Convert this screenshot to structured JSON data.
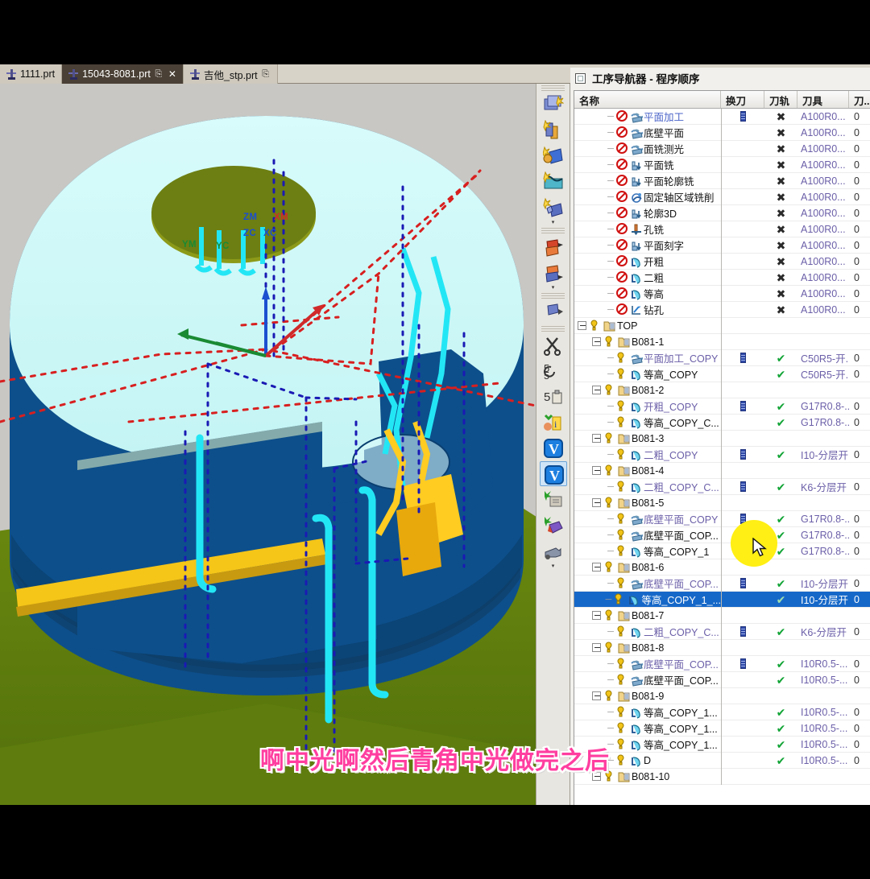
{
  "window": {
    "tabs": [
      {
        "label": "1111.prt",
        "active": false,
        "has_save": false,
        "has_close": false,
        "icon": "part-file-icon"
      },
      {
        "label": "15043-8081.prt",
        "active": true,
        "has_save": true,
        "has_close": true,
        "icon": "part-file-icon"
      },
      {
        "label": "吉他_stp.prt",
        "active": false,
        "has_save": true,
        "has_close": false,
        "icon": "part-file-icon"
      }
    ]
  },
  "viewport": {
    "background_color": "#c8c7c3",
    "part_colors": {
      "stock_top": "#ccf7f7",
      "wall": "#0d4f8b",
      "base_green": "#5e7d0e",
      "toolpath_cyan": "#23e6f5",
      "toolpath_gold": "#ffcc22",
      "rapid_red": "#d81f1f",
      "rapid_blue": "#1a1ab4"
    },
    "axis_labels": [
      {
        "name": "ZM",
        "color": "#1b4fd0"
      },
      {
        "name": "XM",
        "color": "#d02a2a"
      },
      {
        "name": "ZC",
        "color": "#1b4fd0"
      },
      {
        "name": "XC",
        "color": "#1b4fd0"
      },
      {
        "name": "YM",
        "color": "#1a8a33"
      },
      {
        "name": "YC",
        "color": "#1a8a33"
      }
    ]
  },
  "toolbar": {
    "name": "operation-toolbar",
    "buttons": [
      {
        "name": "create-geometry-button",
        "icon": "create-geometry-icon"
      },
      {
        "name": "create-tool-button",
        "icon": "create-tool-icon"
      },
      {
        "name": "create-method-button",
        "icon": "create-method-icon"
      },
      {
        "name": "workpiece-button",
        "icon": "workpiece-icon"
      },
      {
        "name": "create-operation-button",
        "icon": "create-operation-icon"
      },
      {
        "name": "generate-toolpath-button",
        "icon": "generate-toolpath-icon"
      },
      {
        "name": "replay-toolpath-button",
        "icon": "replay-toolpath-icon"
      },
      {
        "name": "verify-toolpath-button",
        "icon": "verify-toolpath-icon"
      },
      {
        "name": "cut-toolpath-button",
        "icon": "cut-toolpath-icon"
      },
      {
        "name": "copy-toolpath-button",
        "icon": "copy-toolpath-icon"
      },
      {
        "name": "paste-toolpath-button",
        "icon": "paste-toolpath-icon"
      },
      {
        "name": "transform-button",
        "icon": "transform-icon"
      },
      {
        "name": "information-button",
        "icon": "information-icon"
      },
      {
        "name": "vericut-button",
        "icon": "vericut-icon",
        "selected": true
      },
      {
        "name": "post-process-button",
        "icon": "post-process-icon"
      },
      {
        "name": "shop-doc-button",
        "icon": "shop-doc-icon"
      },
      {
        "name": "machine-sim-button",
        "icon": "machine-sim-icon"
      }
    ]
  },
  "navigator": {
    "title": "工序导航器 - 程序顺序",
    "columns": [
      "名称",
      "换刀",
      "刀轨",
      "刀具",
      "刀..."
    ],
    "scrollbar": {
      "left_arrow": "‹"
    },
    "rows": [
      {
        "indent": 2,
        "guide": "dash",
        "icon": "face-milling-icon",
        "label": "平面加工",
        "label_color": "blue",
        "status": "blocked",
        "toolchange": true,
        "path": "x",
        "tool": "A100R0...",
        "tn": "0"
      },
      {
        "indent": 2,
        "guide": "dash",
        "icon": "face-milling-icon",
        "label": "底壁平面",
        "label_color": "black",
        "status": "blocked",
        "toolchange": false,
        "path": "x",
        "tool": "A100R0...",
        "tn": "0"
      },
      {
        "indent": 2,
        "guide": "dash",
        "icon": "face-milling-icon",
        "label": "面铣测光",
        "label_color": "black",
        "status": "blocked",
        "toolchange": false,
        "path": "x",
        "tool": "A100R0...",
        "tn": "0"
      },
      {
        "indent": 2,
        "guide": "dash",
        "icon": "planar-mill-icon",
        "label": "平面铣",
        "label_color": "black",
        "status": "blocked",
        "toolchange": false,
        "path": "x",
        "tool": "A100R0...",
        "tn": "0"
      },
      {
        "indent": 2,
        "guide": "dash",
        "icon": "planar-mill-icon",
        "label": "平面轮廓铣",
        "label_color": "black",
        "status": "blocked",
        "toolchange": false,
        "path": "x",
        "tool": "A100R0...",
        "tn": "0"
      },
      {
        "indent": 2,
        "guide": "dash",
        "icon": "fixed-contour-icon",
        "label": "固定轴区域铣削",
        "label_color": "black",
        "status": "blocked",
        "toolchange": false,
        "path": "x",
        "tool": "A100R0...",
        "tn": "0"
      },
      {
        "indent": 2,
        "guide": "dash",
        "icon": "planar-mill-icon",
        "label": "轮廓3D",
        "label_color": "black",
        "status": "blocked",
        "toolchange": false,
        "path": "x",
        "tool": "A100R0...",
        "tn": "0"
      },
      {
        "indent": 2,
        "guide": "dash",
        "icon": "hole-milling-icon",
        "label": "孔铣",
        "label_color": "black",
        "status": "blocked",
        "toolchange": false,
        "path": "x",
        "tool": "A100R0...",
        "tn": "0"
      },
      {
        "indent": 2,
        "guide": "dash",
        "icon": "planar-mill-icon",
        "label": "平面刻字",
        "label_color": "black",
        "status": "blocked",
        "toolchange": false,
        "path": "x",
        "tool": "A100R0...",
        "tn": "0"
      },
      {
        "indent": 2,
        "guide": "dash",
        "icon": "cavity-mill-icon",
        "label": "开粗",
        "label_color": "black",
        "status": "blocked",
        "toolchange": false,
        "path": "x",
        "tool": "A100R0...",
        "tn": "0"
      },
      {
        "indent": 2,
        "guide": "dash",
        "icon": "cavity-mill-icon",
        "label": "二粗",
        "label_color": "black",
        "status": "blocked",
        "toolchange": false,
        "path": "x",
        "tool": "A100R0...",
        "tn": "0"
      },
      {
        "indent": 2,
        "guide": "dash",
        "icon": "cavity-mill-icon",
        "label": "等高",
        "label_color": "black",
        "status": "blocked",
        "toolchange": false,
        "path": "x",
        "tool": "A100R0...",
        "tn": "0"
      },
      {
        "indent": 2,
        "guide": "dash",
        "icon": "drilling-icon",
        "label": "钻孔",
        "label_color": "black",
        "status": "blocked",
        "toolchange": false,
        "path": "x",
        "tool": "A100R0...",
        "tn": "0"
      },
      {
        "indent": 0,
        "guide": "expander",
        "icon": "program-group-icon",
        "label": "TOP",
        "label_color": "black",
        "status": "warn",
        "toolchange": false,
        "path": "",
        "tool": "",
        "tn": ""
      },
      {
        "indent": 1,
        "guide": "expander",
        "icon": "program-group-icon",
        "label": "B081-1",
        "label_color": "black",
        "status": "warn",
        "toolchange": false,
        "path": "",
        "tool": "",
        "tn": ""
      },
      {
        "indent": 2,
        "guide": "dash",
        "icon": "face-milling-icon",
        "label": "平面加工_COPY",
        "label_color": "purple",
        "status": "warn",
        "toolchange": true,
        "path": "ok",
        "tool": "C50R5-开...",
        "tn": "0"
      },
      {
        "indent": 2,
        "guide": "dash",
        "icon": "cavity-mill-icon",
        "label": "等高_COPY",
        "label_color": "black",
        "status": "warn",
        "toolchange": false,
        "path": "ok",
        "tool": "C50R5-开...",
        "tn": "0"
      },
      {
        "indent": 1,
        "guide": "expander",
        "icon": "program-group-icon",
        "label": "B081-2",
        "label_color": "black",
        "status": "warn",
        "toolchange": false,
        "path": "",
        "tool": "",
        "tn": ""
      },
      {
        "indent": 2,
        "guide": "dash",
        "icon": "cavity-mill-icon",
        "label": "开粗_COPY",
        "label_color": "purple",
        "status": "warn",
        "toolchange": true,
        "path": "ok",
        "tool": "G17R0.8-...",
        "tn": "0"
      },
      {
        "indent": 2,
        "guide": "dash",
        "icon": "cavity-mill-icon",
        "label": "等高_COPY_C...",
        "label_color": "black",
        "status": "warn",
        "toolchange": false,
        "path": "ok",
        "tool": "G17R0.8-...",
        "tn": "0"
      },
      {
        "indent": 1,
        "guide": "expander",
        "icon": "program-group-icon",
        "label": "B081-3",
        "label_color": "black",
        "status": "warn",
        "toolchange": false,
        "path": "",
        "tool": "",
        "tn": ""
      },
      {
        "indent": 2,
        "guide": "dash",
        "icon": "cavity-mill-icon",
        "label": "二粗_COPY",
        "label_color": "purple",
        "status": "warn",
        "toolchange": true,
        "path": "ok",
        "tool": "I10-分层开",
        "tn": "0"
      },
      {
        "indent": 1,
        "guide": "expander",
        "icon": "program-group-icon",
        "label": "B081-4",
        "label_color": "black",
        "status": "warn",
        "toolchange": false,
        "path": "",
        "tool": "",
        "tn": ""
      },
      {
        "indent": 2,
        "guide": "dash",
        "icon": "cavity-mill-icon",
        "label": "二粗_COPY_C...",
        "label_color": "purple",
        "status": "warn",
        "toolchange": true,
        "path": "ok",
        "tool": "K6-分层开",
        "tn": "0"
      },
      {
        "indent": 1,
        "guide": "expander",
        "icon": "program-group-icon",
        "label": "B081-5",
        "label_color": "black",
        "status": "warn",
        "toolchange": false,
        "path": "",
        "tool": "",
        "tn": ""
      },
      {
        "indent": 2,
        "guide": "dash",
        "icon": "face-milling-icon",
        "label": "底壁平面_COPY",
        "label_color": "purple",
        "status": "warn",
        "toolchange": true,
        "path": "ok",
        "tool": "G17R0.8-...",
        "tn": "0"
      },
      {
        "indent": 2,
        "guide": "dash",
        "icon": "face-milling-icon",
        "label": "底壁平面_COP...",
        "label_color": "black",
        "status": "warn",
        "toolchange": false,
        "path": "ok",
        "tool": "G17R0.8-...",
        "tn": "0"
      },
      {
        "indent": 2,
        "guide": "dash",
        "icon": "cavity-mill-icon",
        "label": "等高_COPY_1",
        "label_color": "black",
        "status": "warn",
        "toolchange": false,
        "path": "ok",
        "tool": "G17R0.8-...",
        "tn": "0"
      },
      {
        "indent": 1,
        "guide": "expander",
        "icon": "program-group-icon",
        "label": "B081-6",
        "label_color": "black",
        "status": "warn",
        "toolchange": false,
        "path": "",
        "tool": "",
        "tn": ""
      },
      {
        "indent": 2,
        "guide": "dash",
        "icon": "face-milling-icon",
        "label": "底壁平面_COP...",
        "label_color": "purple",
        "status": "warn",
        "toolchange": true,
        "path": "ok",
        "tool": "I10-分层开",
        "tn": "0"
      },
      {
        "indent": 2,
        "guide": "dash",
        "icon": "cavity-mill-icon",
        "label": "等高_COPY_1_...",
        "label_color": "black",
        "status": "warn",
        "toolchange": false,
        "path": "ok",
        "tool": "I10-分层开",
        "tn": "0",
        "selected": true
      },
      {
        "indent": 1,
        "guide": "expander",
        "icon": "program-group-icon",
        "label": "B081-7",
        "label_color": "black",
        "status": "warn",
        "toolchange": false,
        "path": "",
        "tool": "",
        "tn": ""
      },
      {
        "indent": 2,
        "guide": "dash",
        "icon": "cavity-mill-icon",
        "label": "二粗_COPY_C...",
        "label_color": "purple",
        "status": "warn",
        "toolchange": true,
        "path": "ok",
        "tool": "K6-分层开",
        "tn": "0"
      },
      {
        "indent": 1,
        "guide": "expander",
        "icon": "program-group-icon",
        "label": "B081-8",
        "label_color": "black",
        "status": "warn",
        "toolchange": false,
        "path": "",
        "tool": "",
        "tn": ""
      },
      {
        "indent": 2,
        "guide": "dash",
        "icon": "face-milling-icon",
        "label": "底壁平面_COP...",
        "label_color": "purple",
        "status": "warn",
        "toolchange": true,
        "path": "ok",
        "tool": "I10R0.5-...",
        "tn": "0"
      },
      {
        "indent": 2,
        "guide": "dash",
        "icon": "face-milling-icon",
        "label": "底壁平面_COP...",
        "label_color": "black",
        "status": "warn",
        "toolchange": false,
        "path": "ok",
        "tool": "I10R0.5-...",
        "tn": "0"
      },
      {
        "indent": 1,
        "guide": "expander",
        "icon": "program-group-icon",
        "label": "B081-9",
        "label_color": "black",
        "status": "warn",
        "toolchange": false,
        "path": "",
        "tool": "",
        "tn": ""
      },
      {
        "indent": 2,
        "guide": "dash",
        "icon": "cavity-mill-icon",
        "label": "等高_COPY_1...",
        "label_color": "black",
        "status": "warn",
        "toolchange": false,
        "path": "ok",
        "tool": "I10R0.5-...",
        "tn": "0"
      },
      {
        "indent": 2,
        "guide": "dash",
        "icon": "cavity-mill-icon",
        "label": "等高_COPY_1...",
        "label_color": "black",
        "status": "warn",
        "toolchange": false,
        "path": "ok",
        "tool": "I10R0.5-...",
        "tn": "0"
      },
      {
        "indent": 2,
        "guide": "dash",
        "icon": "cavity-mill-icon",
        "label": "等高_COPY_1...",
        "label_color": "black",
        "status": "warn",
        "toolchange": false,
        "path": "ok",
        "tool": "I10R0.5-...",
        "tn": "0"
      },
      {
        "indent": 2,
        "guide": "dash",
        "icon": "cavity-mill-icon",
        "label": "D",
        "label_color": "black",
        "status": "warn",
        "toolchange": false,
        "path": "ok",
        "tool": "I10R0.5-...",
        "tn": "0"
      },
      {
        "indent": 1,
        "guide": "expander",
        "icon": "program-group-icon",
        "label": "B081-10",
        "label_color": "black",
        "status": "warn",
        "toolchange": false,
        "path": "",
        "tool": "",
        "tn": ""
      }
    ]
  },
  "subtitle": {
    "text": "啊中光啊然后青角中光做完之后",
    "color": "#ff3ea0"
  }
}
